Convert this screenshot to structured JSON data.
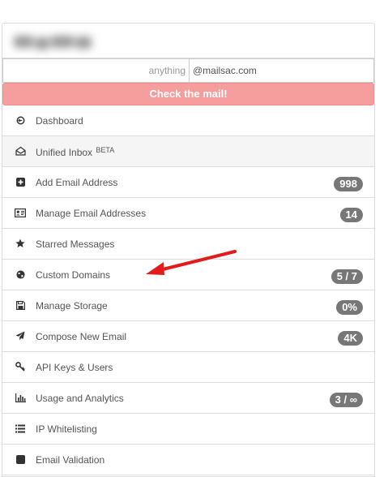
{
  "search": {
    "placeholder": "anything",
    "domain": "@mailsac.com",
    "check_label": "Check the mail!"
  },
  "menu": {
    "items": [
      {
        "label": "Dashboard",
        "icon": "dashboard-icon",
        "badge": ""
      },
      {
        "label": "Unified Inbox",
        "sup": "BETA",
        "icon": "envelope-open-icon",
        "badge": ""
      },
      {
        "label": "Add Email Address",
        "icon": "plus-square-icon",
        "badge": "998"
      },
      {
        "label": "Manage Email Addresses",
        "icon": "id-card-icon",
        "badge": "14"
      },
      {
        "label": "Starred Messages",
        "icon": "star-icon",
        "badge": ""
      },
      {
        "label": "Custom Domains",
        "icon": "globe-icon",
        "badge": "5 / 7"
      },
      {
        "label": "Manage Storage",
        "icon": "floppy-disk-icon",
        "badge": "0%"
      },
      {
        "label": "Compose New Email",
        "icon": "paper-plane-icon",
        "badge": "4K"
      },
      {
        "label": "API Keys & Users",
        "icon": "key-icon",
        "badge": ""
      },
      {
        "label": "Usage and Analytics",
        "icon": "bar-chart-icon",
        "badge": "3 / ∞"
      },
      {
        "label": "IP Whitelisting",
        "icon": "list-icon",
        "badge": ""
      },
      {
        "label": "Email Validation",
        "icon": "check-square-icon",
        "badge": ""
      }
    ]
  },
  "colors": {
    "check_button": "#f69d9d",
    "badge": "#777777",
    "arrow": "#e31b1b"
  }
}
